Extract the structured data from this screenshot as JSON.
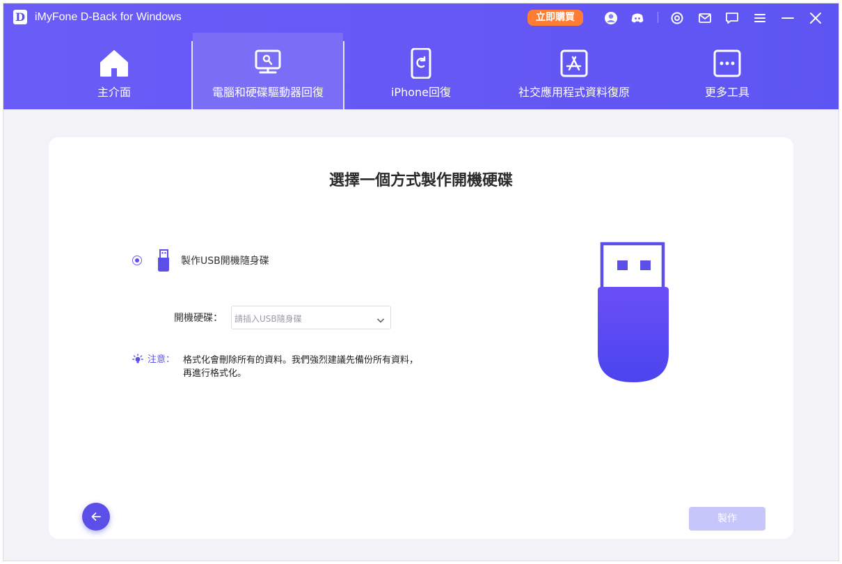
{
  "app": {
    "logo_letter": "D",
    "title": "iMyFone D-Back for Windows",
    "buy_label": "立即購買"
  },
  "titlebar_icons": [
    "account-icon",
    "discord-icon",
    "settings-icon",
    "mail-icon",
    "feedback-icon",
    "menu-icon",
    "minimize-icon",
    "close-icon"
  ],
  "nav": {
    "items": [
      {
        "label": "主介面",
        "icon": "home-icon",
        "active": false
      },
      {
        "label": "電腦和硬碟驅動器回復",
        "icon": "pc-recovery-icon",
        "active": true
      },
      {
        "label": "iPhone回復",
        "icon": "iphone-icon",
        "active": false
      },
      {
        "label": "社交應用程式資料復原",
        "icon": "app-store-icon",
        "active": false
      },
      {
        "label": "更多工具",
        "icon": "more-tools-icon",
        "active": false
      }
    ]
  },
  "main": {
    "title": "選擇一個方式製作開機硬碟",
    "option_label": "製作USB開機隨身碟",
    "option_selected": true,
    "disk_label": "開機硬碟：",
    "disk_placeholder": "請插入USB隨身碟",
    "note_label": "注意：",
    "note_text": "格式化會刪除所有的資料。我們強烈建議先備份所有資料，再進行格式化。",
    "make_button": "製作"
  },
  "colors": {
    "accent": "#5b4fe8",
    "header": "#6658f5",
    "buy": "#ff7c33",
    "disabled_button": "#c6c6fb"
  }
}
